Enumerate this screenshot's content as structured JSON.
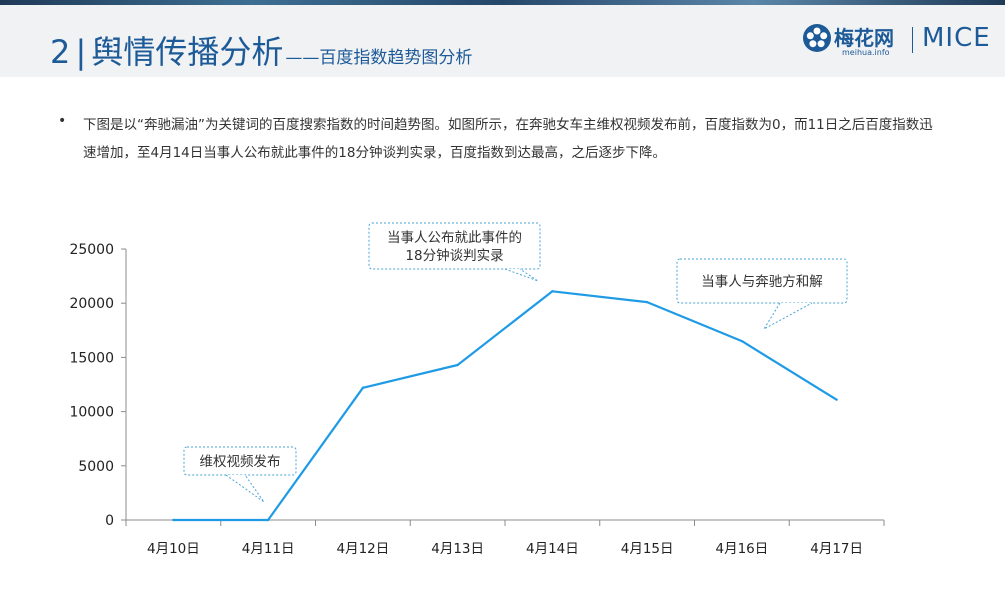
{
  "header": {
    "number": "2",
    "separator": "|",
    "title": "舆情传播分析",
    "subtitle": "——百度指数趋势图分析"
  },
  "logo": {
    "name_cn": "梅花网",
    "url": "meihua.info",
    "name_en": "MICE"
  },
  "bullet_symbol": "•",
  "paragraph": "下图是以“奔驰漏油”为关键词的百度搜索指数的时间趋势图。如图所示，在奔驰女车主维权视频发布前，百度指数为0，而11日之后百度指数迅速增加，至4月14日当事人公布就此事件的18分钟谈判实录，百度指数到达最高，之后逐步下降。",
  "colors": {
    "accent": "#1d5a98",
    "line": "#1f9be6",
    "callout_border": "#4aa3d6"
  },
  "chart_data": {
    "type": "line",
    "categories": [
      "4月10日",
      "4月11日",
      "4月12日",
      "4月13日",
      "4月14日",
      "4月15日",
      "4月16日",
      "4月17日"
    ],
    "series": [
      {
        "values": [
          0,
          0,
          12200,
          14300,
          21100,
          20100,
          16500,
          11100
        ]
      }
    ],
    "y_ticks": [
      0,
      5000,
      10000,
      15000,
      20000,
      25000
    ],
    "y_tick_labels": [
      "0",
      "5000",
      "10000",
      "15000",
      "20000",
      "25000"
    ],
    "ylim": [
      0,
      25000
    ],
    "grid": false,
    "title": "",
    "xlabel": "",
    "ylabel": "",
    "annotations": [
      {
        "lines": [
          "维权视频发布"
        ],
        "point_index": 1
      },
      {
        "lines": [
          "当事人公布就此事件的",
          "18分钟谈判实录"
        ],
        "point_index": 4
      },
      {
        "lines": [
          "当事人与奔驰方和解"
        ],
        "point_index": 6
      }
    ]
  }
}
